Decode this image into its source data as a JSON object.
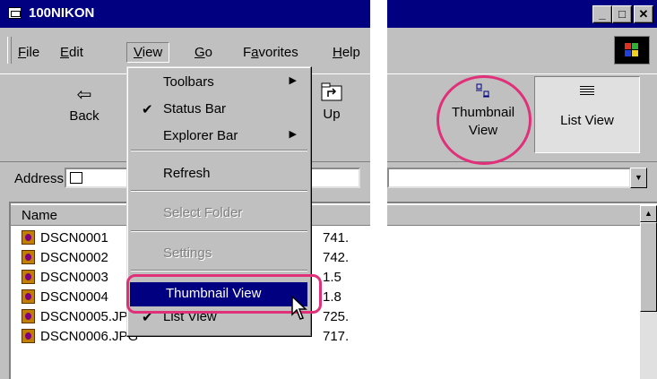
{
  "window": {
    "title": "100NIKON"
  },
  "menubar": {
    "items": [
      {
        "label": "File",
        "key": "F"
      },
      {
        "label": "Edit",
        "key": "E"
      },
      {
        "label": "View",
        "key": "V"
      },
      {
        "label": "Go",
        "key": "G"
      },
      {
        "label": "Favorites",
        "key": "a"
      },
      {
        "label": "Help",
        "key": "H"
      }
    ],
    "active": "View"
  },
  "toolbar": {
    "back_label": "Back",
    "up_label": "Up",
    "thumbnail_label": "Thumbnail View",
    "list_label": "List View"
  },
  "address": {
    "label": "Address"
  },
  "view_menu": {
    "items": [
      {
        "label": "Toolbars",
        "submenu": true,
        "checked": false,
        "disabled": false
      },
      {
        "label": "Status Bar",
        "submenu": false,
        "checked": true,
        "disabled": false
      },
      {
        "label": "Explorer Bar",
        "submenu": true,
        "checked": false,
        "disabled": false
      },
      {
        "label": "Refresh",
        "submenu": false,
        "checked": false,
        "disabled": false
      },
      {
        "label": "Select Folder",
        "submenu": false,
        "checked": false,
        "disabled": true
      },
      {
        "label": "Settings",
        "submenu": false,
        "checked": false,
        "disabled": true
      },
      {
        "label": "Thumbnail View",
        "submenu": false,
        "checked": false,
        "disabled": false,
        "highlighted": true
      },
      {
        "label": "List View",
        "submenu": false,
        "checked": true,
        "disabled": false
      }
    ],
    "check_glyph": "✔",
    "arrow_glyph": "▶"
  },
  "filelist": {
    "column_name": "Name",
    "rows": [
      {
        "name": "DSCN0001",
        "size": "741."
      },
      {
        "name": "DSCN0002",
        "size": "742."
      },
      {
        "name": "DSCN0003",
        "size": "1.5"
      },
      {
        "name": "DSCN0004",
        "size": "1.8"
      },
      {
        "name": "DSCN0005.JPG",
        "size": "725."
      },
      {
        "name": "DSCN0006.JPG",
        "size": "717."
      }
    ]
  },
  "colors": {
    "titlebar": "#000080",
    "highlight": "#000080",
    "callout": "#e0307a",
    "face": "#c0c0c0"
  }
}
